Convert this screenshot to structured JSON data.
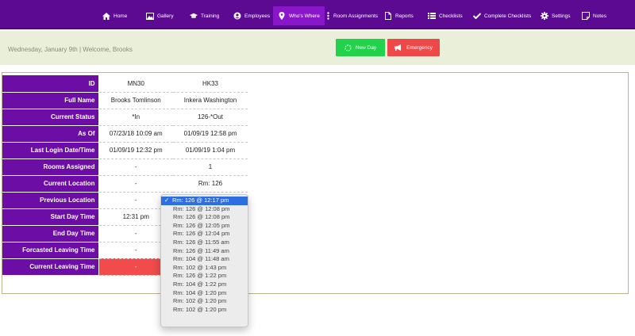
{
  "nav": {
    "items": [
      {
        "label": "Home",
        "icon": "home-icon"
      },
      {
        "label": "Gallery",
        "icon": "image-icon"
      },
      {
        "label": "Training",
        "icon": "graduation-cap-icon"
      },
      {
        "label": "Employees",
        "icon": "user-circle-icon"
      },
      {
        "label": "Who's Where",
        "icon": "map-pin-icon",
        "active": true
      },
      {
        "label": "Room Assignments",
        "icon": "vertical-dots-icon"
      },
      {
        "label": "Reports",
        "icon": "document-icon"
      },
      {
        "label": "Checklists",
        "icon": "list-icon"
      },
      {
        "label": "Complete Checklists",
        "icon": "checkmark-icon"
      },
      {
        "label": "Settings",
        "icon": "gear-icon"
      },
      {
        "label": "Notes",
        "icon": "note-icon"
      }
    ]
  },
  "header": {
    "greeting": "Wednesday, January 9th | Welcome, Brooks",
    "new_day_label": "New Day",
    "emergency_label": "Emergency"
  },
  "table": {
    "rows": [
      {
        "label": "ID",
        "values": [
          "MN30",
          "HK33"
        ]
      },
      {
        "label": "Full Name",
        "values": [
          "Brooks Tomlinson",
          "Inkera Washington"
        ]
      },
      {
        "label": "Current Status",
        "values": [
          "*In",
          "126-*Out"
        ]
      },
      {
        "label": "As Of",
        "values": [
          "07/23/18 10:09 am",
          "01/09/19 12:58 pm"
        ]
      },
      {
        "label": "Last Login Date/Time",
        "values": [
          "01/09/19 12:32 pm",
          "01/09/19 1:04 pm"
        ]
      },
      {
        "label": "Rooms Assigned",
        "values": [
          "-",
          "1"
        ]
      },
      {
        "label": "Current Location",
        "values": [
          "-",
          "Rm: 126"
        ]
      },
      {
        "label": "Previous Location",
        "values": [
          "-",
          ""
        ]
      },
      {
        "label": "Start Day Time",
        "values": [
          "12:31 pm",
          ""
        ]
      },
      {
        "label": "End Day Time",
        "values": [
          "-",
          ""
        ]
      },
      {
        "label": "Forcasted Leaving Time",
        "values": [
          "-",
          ""
        ]
      },
      {
        "label": "Current Leaving Time",
        "values": [
          "-",
          ""
        ]
      }
    ]
  },
  "dropdown": {
    "selected_index": 0,
    "options": [
      "Rm: 126 @ 12:17 pm",
      "Rm: 126 @ 12:08 pm",
      "Rm: 126 @ 12:08 pm",
      "Rm: 126 @ 12:05 pm",
      "Rm: 126 @ 12:04 pm",
      "Rm: 126 @ 11:55 am",
      "Rm: 126 @ 11:49 am",
      "Rm: 104 @ 11:48 am",
      "Rm: 102 @ 1:43 pm",
      "Rm: 126 @ 1:22 pm",
      "Rm: 104 @ 1:22 pm",
      "Rm: 104 @ 1:20 pm",
      "Rm: 102 @ 1:20 pm",
      "Rm: 102 @ 1:20 pm"
    ]
  },
  "colors": {
    "nav_bg": "#5b0a91",
    "nav_active": "#8a16c9",
    "header_bg": "#e9efd8",
    "new_day": "#22d24b",
    "emergency": "#ef4848",
    "row_header": "#6c0ea6"
  }
}
